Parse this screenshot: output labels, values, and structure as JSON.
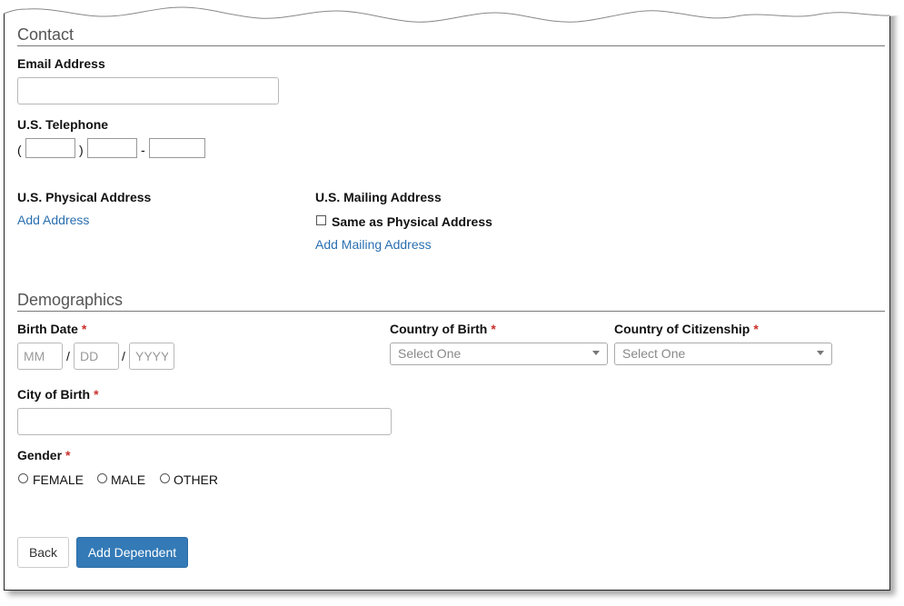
{
  "contact": {
    "section_title": "Contact",
    "email_label": "Email Address",
    "email_value": "",
    "phone_label": "U.S. Telephone",
    "phone_open_paren": "(",
    "phone_close_paren": ")",
    "phone_dash": "-",
    "physical_address_label": "U.S. Physical Address",
    "add_address_link": "Add Address",
    "mailing_address_label": "U.S. Mailing Address",
    "same_as_physical_label": "Same as Physical Address",
    "add_mailing_link": "Add Mailing Address"
  },
  "demographics": {
    "section_title": "Demographics",
    "birth_date_label": "Birth Date",
    "required_marker": "*",
    "month_placeholder": "MM",
    "day_placeholder": "DD",
    "year_placeholder": "YYYY",
    "date_separator": "/",
    "country_birth_label": "Country of Birth",
    "country_birth_value": "Select One",
    "country_citizenship_label": "Country of Citizenship",
    "country_citizenship_value": "Select One",
    "city_birth_label": "City of Birth",
    "gender_label": "Gender",
    "gender_options": [
      "FEMALE",
      "MALE",
      "OTHER"
    ]
  },
  "actions": {
    "back_label": "Back",
    "add_dependent_label": "Add Dependent"
  },
  "colors": {
    "link": "#2a6fb0",
    "primary_button": "#337ab7",
    "required": "#c9302c"
  }
}
